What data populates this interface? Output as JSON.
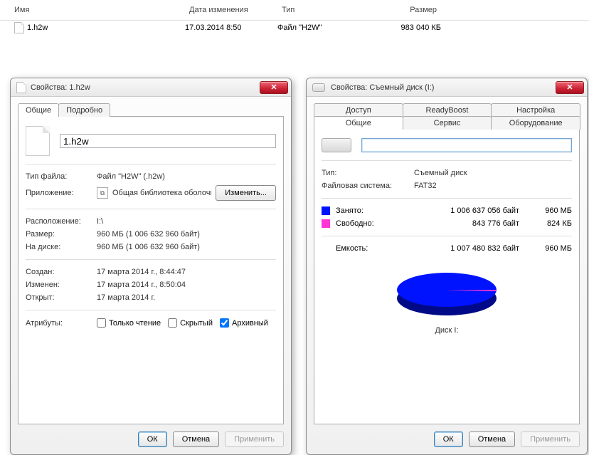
{
  "file_list": {
    "headers": {
      "name": "Имя",
      "date": "Дата изменения",
      "type": "Тип",
      "size": "Размер"
    },
    "rows": [
      {
        "name": "1.h2w",
        "date": "17.03.2014 8:50",
        "type": "Файл \"H2W\"",
        "size": "983 040 КБ"
      }
    ]
  },
  "file_dialog": {
    "title": "Свойства: 1.h2w",
    "tabs": {
      "general": "Общие",
      "details": "Подробно"
    },
    "filename": "1.h2w",
    "labels": {
      "type": "Тип файла:",
      "app": "Приложение:",
      "change": "Изменить...",
      "location": "Расположение:",
      "size": "Размер:",
      "ondisk": "На диске:",
      "created": "Создан:",
      "modified": "Изменен:",
      "accessed": "Открыт:",
      "attributes": "Атрибуты:",
      "readonly": "Только чтение",
      "hidden": "Скрытый",
      "archive": "Архивный"
    },
    "values": {
      "type": "Файл \"H2W\" (.h2w)",
      "app": "Общая библиотека оболочки W",
      "location": "I:\\",
      "size": "960 МБ (1 006 632 960 байт)",
      "ondisk": "960 МБ (1 006 632 960 байт)",
      "created": "17 марта 2014 г., 8:44:47",
      "modified": "17 марта 2014 г., 8:50:04",
      "accessed": "17 марта 2014 г."
    },
    "attrs": {
      "readonly": false,
      "hidden": false,
      "archive": true
    },
    "buttons": {
      "ok": "ОК",
      "cancel": "Отмена",
      "apply": "Применить"
    }
  },
  "drive_dialog": {
    "title": "Свойства: Съемный диск (I:)",
    "tabs_row1": {
      "access": "Доступ",
      "readyboost": "ReadyBoost",
      "settings": "Настройка"
    },
    "tabs_row2": {
      "general": "Общие",
      "service": "Сервис",
      "hardware": "Оборудование"
    },
    "labels": {
      "type": "Тип:",
      "fs": "Файловая система:",
      "used": "Занято:",
      "free": "Свободно:",
      "capacity": "Емкость:",
      "disk": "Диск I:"
    },
    "values": {
      "type": "Съемный диск",
      "fs": "FAT32",
      "used_bytes": "1 006 637 056 байт",
      "used_h": "960 МБ",
      "free_bytes": "843 776 байт",
      "free_h": "824 КБ",
      "cap_bytes": "1 007 480 832 байт",
      "cap_h": "960 МБ"
    },
    "buttons": {
      "ok": "ОК",
      "cancel": "Отмена",
      "apply": "Применить"
    },
    "label_value": ""
  },
  "chart_data": {
    "type": "pie",
    "title": "Диск I:",
    "series": [
      {
        "name": "Занято",
        "value": 1006637056,
        "color": "#0013ff"
      },
      {
        "name": "Свободно",
        "value": 843776,
        "color": "#ff33d6"
      }
    ]
  }
}
